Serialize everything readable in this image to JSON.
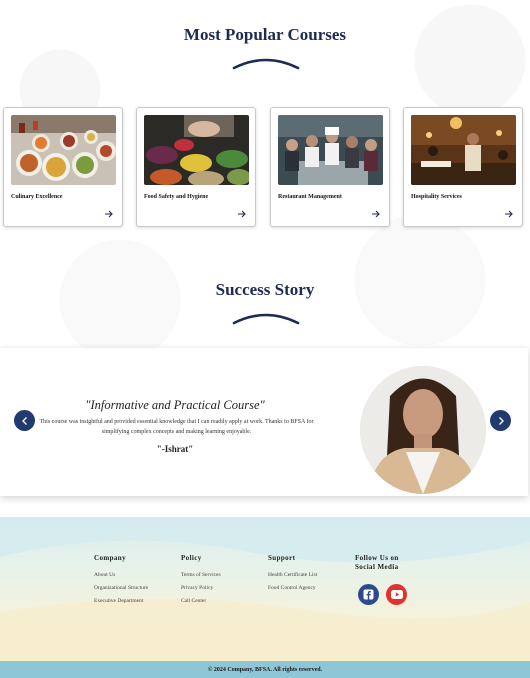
{
  "popular": {
    "title": "Most Popular Courses",
    "courses": [
      {
        "name": "Culinary Excellence"
      },
      {
        "name": "Food Safety and Hygiene"
      },
      {
        "name": "Restaurant Management"
      },
      {
        "name": "Hospitality Services"
      }
    ]
  },
  "success": {
    "title": "Success Story",
    "quote_title": "\"Informative and Practical Course\"",
    "quote_body": "This course was insightful and provided essential knowledge that I can readily apply at work. Thanks to BFSA for simplifying complex concepts and making learning enjoyable.",
    "author": "\"-Ishrat\""
  },
  "footer": {
    "company": {
      "heading": "Company",
      "links": [
        "About Us",
        "Organizational Structure",
        "Executive Department"
      ]
    },
    "policy": {
      "heading": "Policy",
      "links": [
        "Terms of Services",
        "Privacy Policy",
        "Call Center"
      ]
    },
    "support": {
      "heading": "Support",
      "links": [
        "Health Certificate List",
        "Food Control Agency"
      ]
    },
    "social": {
      "heading": "Follow Us on Social Media",
      "icons": [
        "facebook-icon",
        "youtube-icon"
      ]
    },
    "copyright": "© 2024 Company, BFSA. All rights reserved."
  },
  "colors": {
    "navy": "#233a6e",
    "facebook": "#2f4a8a",
    "youtube": "#e0332f",
    "copyright_bar": "#8fc6d6"
  }
}
